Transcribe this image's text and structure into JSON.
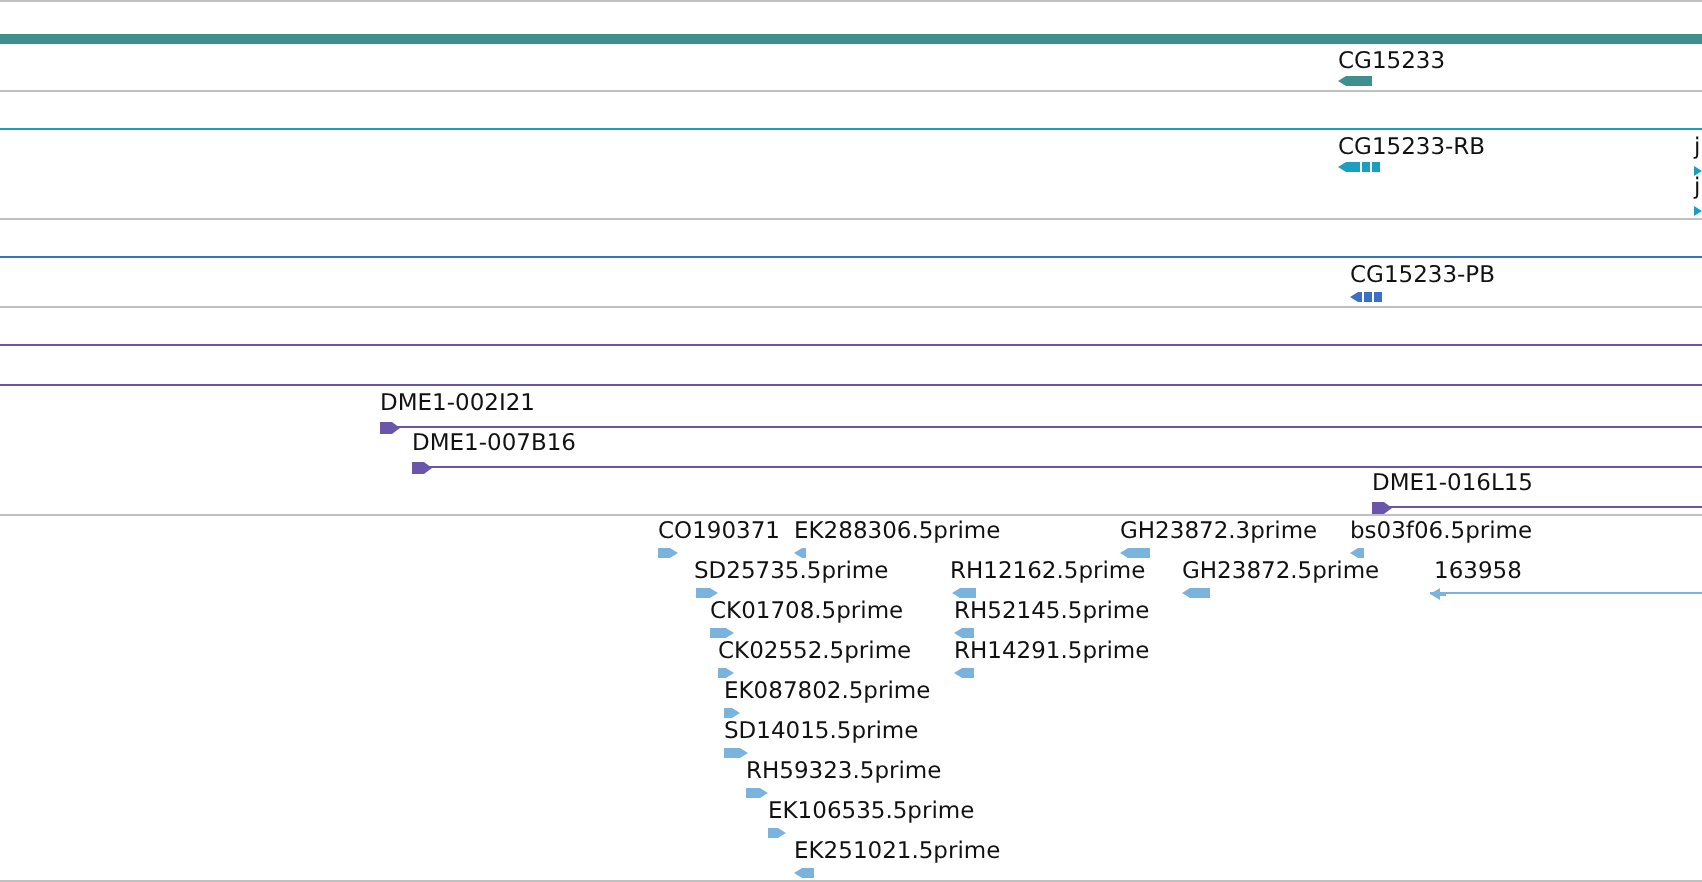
{
  "tracks": [
    {
      "kind": "gene",
      "color": "#3f8f8f",
      "features": [
        {
          "label": "CG15233",
          "reverse": true
        }
      ]
    },
    {
      "kind": "transcript",
      "color": "#1a9fc0",
      "features": [
        {
          "label": "CG15233-RB",
          "reverse": true
        },
        {
          "label": "j",
          "reverse": false
        },
        {
          "label": "j",
          "reverse": false
        }
      ]
    },
    {
      "kind": "transcript",
      "color": "#3a70c8",
      "features": [
        {
          "label": "CG15233-PB",
          "reverse": true
        }
      ]
    },
    {
      "kind": "empty",
      "color": "#6a55a8"
    },
    {
      "kind": "clone",
      "color": "#6a55a8",
      "features": [
        {
          "label": "DME1-002I21",
          "reverse": false
        },
        {
          "label": "DME1-007B16",
          "reverse": false
        },
        {
          "label": "DME1-016L15",
          "reverse": false
        }
      ]
    },
    {
      "kind": "est",
      "color": "#7ab4dc",
      "features": [
        {
          "label": "CO190371",
          "reverse": false
        },
        {
          "label": "EK288306.5prime",
          "reverse": true
        },
        {
          "label": "GH23872.3prime",
          "reverse": true
        },
        {
          "label": "bs03f06.5prime",
          "reverse": true
        },
        {
          "label": "SD25735.5prime",
          "reverse": false
        },
        {
          "label": "RH12162.5prime",
          "reverse": true
        },
        {
          "label": "GH23872.5prime",
          "reverse": true
        },
        {
          "label": "163958",
          "reverse": true
        },
        {
          "label": "CK01708.5prime",
          "reverse": false
        },
        {
          "label": "RH52145.5prime",
          "reverse": true
        },
        {
          "label": "CK02552.5prime",
          "reverse": false
        },
        {
          "label": "RH14291.5prime",
          "reverse": true
        },
        {
          "label": "EK087802.5prime",
          "reverse": false
        },
        {
          "label": "SD14015.5prime",
          "reverse": false
        },
        {
          "label": "RH59323.5prime",
          "reverse": false
        },
        {
          "label": "EK106535.5prime",
          "reverse": false
        },
        {
          "label": "EK251021.5prime",
          "reverse": true
        }
      ]
    }
  ]
}
